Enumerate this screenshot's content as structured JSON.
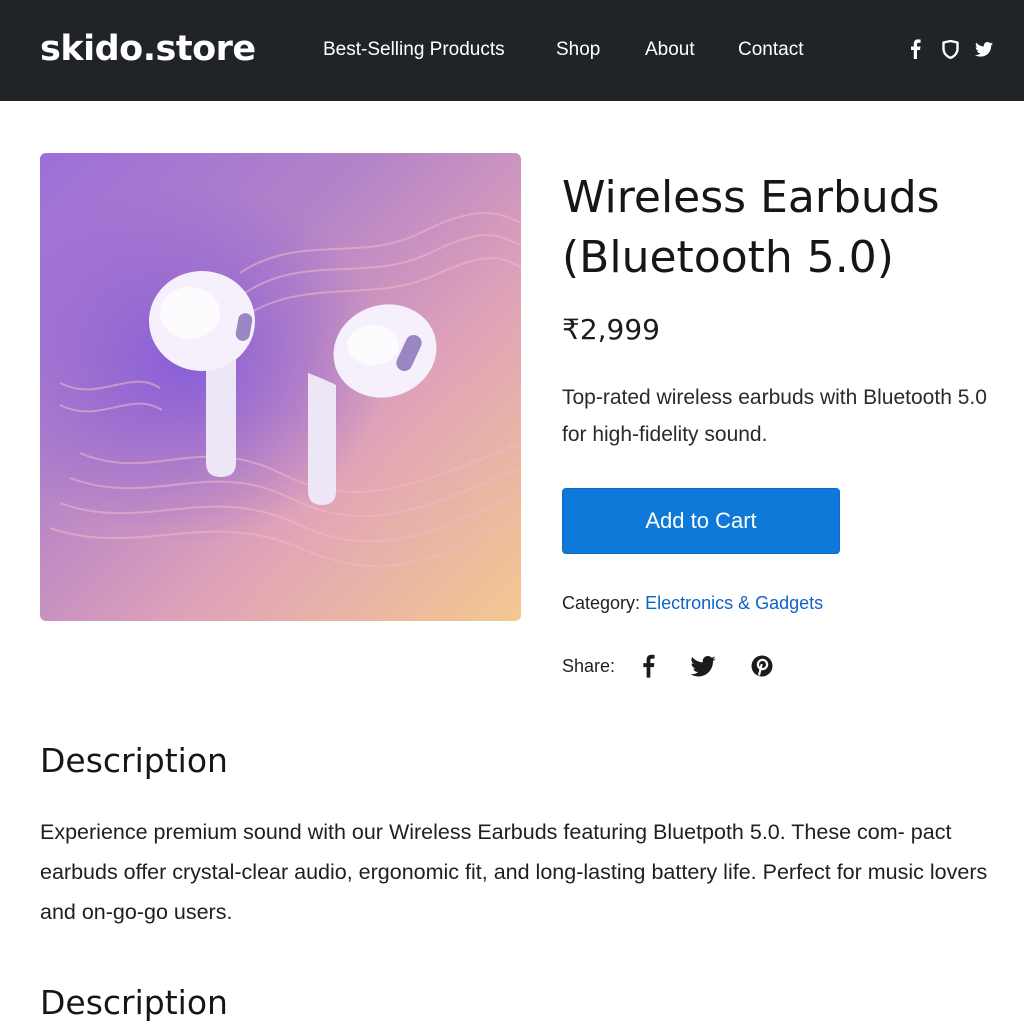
{
  "header": {
    "brand": "skido.store",
    "nav": [
      "Best-Selling Products",
      "Shop",
      "About",
      "Contact"
    ],
    "social_icons": [
      "facebook-icon",
      "shield-icon",
      "twitter-icon"
    ]
  },
  "product": {
    "image_icon": "earbuds-illustration",
    "title": "Wireless Earbuds (Bluetooth 5.0)",
    "price": "₹2,999",
    "short_description": "Top-rated wireless earbuds with Bluetooth 5.0 for high-fidelity sound.",
    "add_to_cart_label": "Add to Cart",
    "category_label": "Category:",
    "category_value": "Electronics & Gadgets",
    "share_label": "Share:",
    "share_icons": [
      "facebook-icon",
      "twitter-icon",
      "pinterest-icon"
    ]
  },
  "description": {
    "heading": "Description",
    "body": "Experience premium sound with our Wireless Earbuds featuring Bluetpoth 5.0. These com- pact earbuds offer crystal-clear audio, ergonomic fit, and long-lasting battery life. Perfect for music lovers and on-go-go users.",
    "heading_2": "Description"
  },
  "colors": {
    "header_bg": "#202428",
    "button_bg": "#0f79d9",
    "link": "#0e63c6"
  }
}
